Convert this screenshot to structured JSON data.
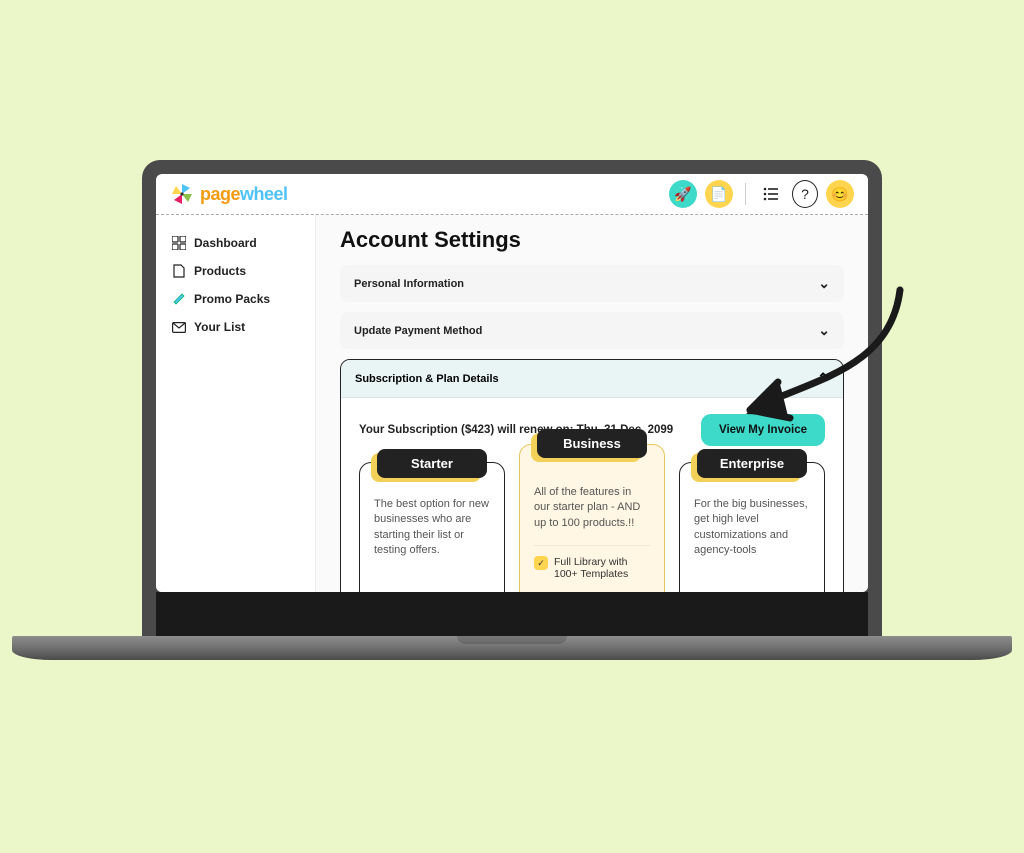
{
  "brand": {
    "name_p1": "page",
    "name_p2": "wheel",
    "name_p3": ""
  },
  "header": {
    "rocket": "🚀",
    "copy": "📄",
    "list": "☰",
    "help": "?",
    "smile": "😊"
  },
  "sidebar": {
    "items": [
      {
        "label": "Dashboard"
      },
      {
        "label": "Products"
      },
      {
        "label": "Promo Packs"
      },
      {
        "label": "Your List"
      }
    ]
  },
  "page": {
    "title": "Account Settings"
  },
  "accordion": {
    "personal": "Personal Information",
    "payment": "Update Payment Method",
    "subscription": "Subscription & Plan Details"
  },
  "subscription": {
    "renew_text": "Your Subscription ($423) will renew on: Thu, 31 Dec, 2099",
    "invoice_btn": "View My Invoice"
  },
  "plans": {
    "starter": {
      "name": "Starter",
      "desc": "The best option for new businesses who are starting their list or testing offers."
    },
    "business": {
      "name": "Business",
      "desc": "All of the features in our starter plan - AND up to 100 products.!!",
      "feature1": "Full Library with 100+ Templates"
    },
    "enterprise": {
      "name": "Enterprise",
      "desc": "For the big businesses, get high level customizations and agency-tools"
    }
  }
}
